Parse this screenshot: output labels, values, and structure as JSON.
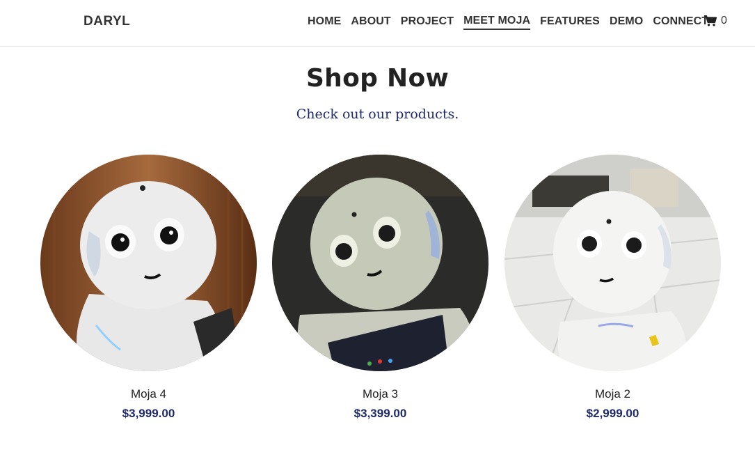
{
  "brand": "DARYL",
  "nav": {
    "items": [
      {
        "label": "HOME"
      },
      {
        "label": "ABOUT"
      },
      {
        "label": "PROJECT"
      },
      {
        "label": "MEET MOJA",
        "active": true
      },
      {
        "label": "FEATURES"
      },
      {
        "label": "DEMO"
      },
      {
        "label": "CONNECT"
      }
    ]
  },
  "cart": {
    "icon": "shopping-cart-icon",
    "count": "0"
  },
  "hero": {
    "title": "Shop Now",
    "subtitle": "Check out our products."
  },
  "products": [
    {
      "name": "Moja 4",
      "price": "$3,999.00"
    },
    {
      "name": "Moja 3",
      "price": "$3,399.00"
    },
    {
      "name": "Moja 2",
      "price": "$2,999.00"
    }
  ],
  "colors": {
    "accent": "#1f2a6b",
    "text": "#222222",
    "border": "#e4e4e4"
  }
}
